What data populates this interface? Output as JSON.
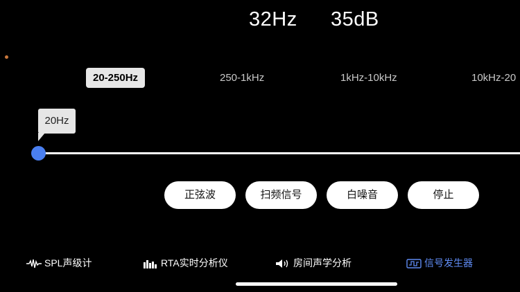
{
  "readout": {
    "frequency": "32Hz",
    "level": "35dB"
  },
  "range_tabs": [
    {
      "label": "20-250Hz",
      "active": true
    },
    {
      "label": "250-1kHz",
      "active": false
    },
    {
      "label": "1kHz-10kHz",
      "active": false
    },
    {
      "label": "10kHz-20",
      "active": false
    }
  ],
  "slider": {
    "tooltip": "20Hz",
    "position_fraction": 0
  },
  "signal_buttons": [
    {
      "label": "正弦波"
    },
    {
      "label": "扫频信号"
    },
    {
      "label": "白噪音"
    },
    {
      "label": "停止"
    }
  ],
  "bottom_nav": [
    {
      "label": "SPL声级计",
      "icon": "waveform-icon",
      "active": false
    },
    {
      "label": "RTA实时分析仪",
      "icon": "spectrum-bars-icon",
      "active": false
    },
    {
      "label": "房间声学分析",
      "icon": "speaker-icon",
      "active": false
    },
    {
      "label": "信号发生器",
      "icon": "signal-generator-icon",
      "active": true
    }
  ],
  "colors": {
    "background": "#000000",
    "accent": "#4a7ff0",
    "active_nav": "#5f8bf3",
    "status_dot": "#c8763b"
  }
}
